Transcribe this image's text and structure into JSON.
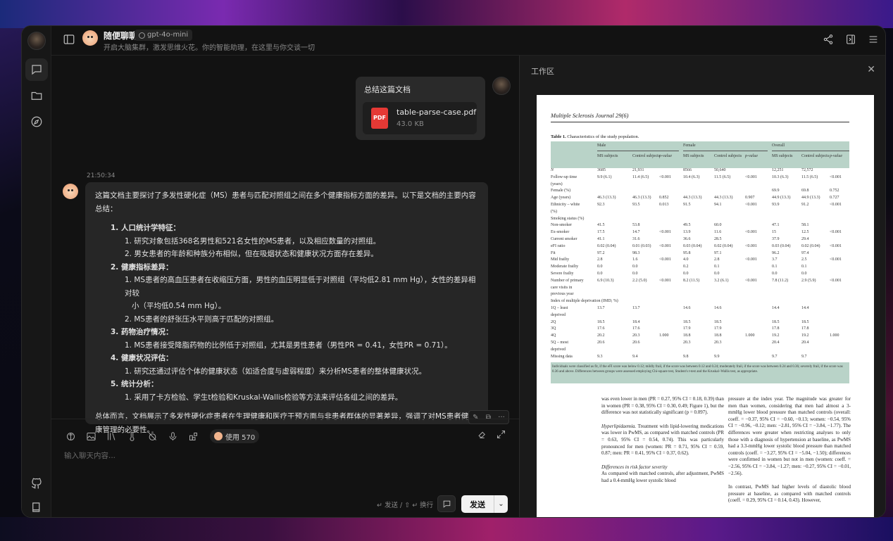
{
  "header": {
    "title": "随便聊聊",
    "model": "gpt-4o-mini",
    "subtitle": "开启大脑集群，激发思维火花。你的智能助理，在这里与你交谈一切"
  },
  "messages": {
    "user_text": "总结这篇文档",
    "file_name": "table-parse-case.pdf",
    "file_size": "43.0 KB",
    "file_type": "PDF",
    "timestamp": "21:50:34",
    "reply": {
      "intro": "这篇文档主要探讨了多发性硬化症（MS）患者与匹配对照组之间在多个健康指标方面的差异。以下是文档的主要内容总结：",
      "s1": "1. 人口统计学特征：",
      "s1_1": "1. 研究对象包括368名男性和521名女性的MS患者，以及相应数量的对照组。",
      "s1_2": "2. 男女患者的年龄和种族分布相似，但在吸烟状态和健康状况方面存在差异。",
      "s2": "2. 健康指标差异：",
      "s2_1a": "1. MS患者的高血压患者在收缩压方面，男性的血压明显低于对照组（平均低2.81 mm Hg），女性的差异相对较",
      "s2_1b": "小（平均低0.54 mm Hg）。",
      "s2_2": "2. MS患者的舒张压水平则高于匹配的对照组。",
      "s3": "3. 药物治疗情况：",
      "s3_1": "1. MS患者接受降脂药物的比例低于对照组，尤其是男性患者（男性PR = 0.41，女性PR = 0.71）。",
      "s4": "4. 健康状况评估：",
      "s4_1": "1. 研究还通过评估个体的健康状态（如适合度与虚弱程度）来分析MS患者的整体健康状况。",
      "s5": "5. 统计分析：",
      "s5_1": "1. 采用了卡方检验、学生t检验和Kruskal-Wallis检验等方法来评估各组之间的差异。",
      "outro_a": "总体而言，文档展示了多发性硬化症患者在生理健康和医疗干预方面与非患者群体的显著差异，强调了对MS患者健",
      "outro_b": "康管理的必要性。"
    },
    "actions": [
      "✎",
      "⧉",
      "···"
    ]
  },
  "composer": {
    "usage_label": "使用 570",
    "placeholder": "输入聊天内容...",
    "send_hint": "↵ 发送 / ⇧ ↵ 换行",
    "send_label": "发送",
    "send_dropdown": "⌄"
  },
  "workspace": {
    "title": "工作区",
    "close": "✕",
    "doc": {
      "journal": "Multiple Sclerosis Journal 29(6)",
      "table_caption_bold": "Table 1.",
      "table_caption": "Characteristics of the study population.",
      "group_headers": [
        "Male",
        "Female",
        "Overall"
      ],
      "sub_headers": [
        "MS subjects",
        "Control subjects",
        "p-value",
        "MS subjects",
        "Control subjects",
        "p-value",
        "MS subjects",
        "Control subjects",
        "p-value"
      ],
      "rows": [
        {
          "label": "N",
          "v": [
            "3685",
            "21,931",
            "",
            "8566",
            "50,640",
            "",
            "12,251",
            "72,572",
            ""
          ]
        },
        {
          "label": "Follow-up time",
          "v": [
            "9.9 (6.1)",
            "11.4 (6.5)",
            "<0.001",
            "10.4 (6.3)",
            "11.5 (6.5)",
            "<0.001",
            "10.3 (6.3)",
            "11.5 (6.5)",
            "<0.001"
          ]
        },
        {
          "label": "(years)",
          "v": [
            "",
            "",
            "",
            "",
            "",
            "",
            "",
            "",
            ""
          ]
        },
        {
          "label": "Female (%)",
          "v": [
            "",
            "",
            "",
            "",
            "",
            "",
            "69.9",
            "69.8",
            "0.752"
          ]
        },
        {
          "label": "Age (years)",
          "v": [
            "46.3 (13.3)",
            "46.3 (13.3)",
            "0.852",
            "44.3 (13.3)",
            "44.3 (13.3)",
            "0.907",
            "44.9 (13.3)",
            "44.9 (13.3)",
            "0.727"
          ]
        },
        {
          "label": "Ethnicity – white",
          "v": [
            "92.3",
            "93.5",
            "0.013",
            "91.5",
            "94.1",
            "<0.001",
            "93.9",
            "91.2",
            "<0.001"
          ]
        },
        {
          "label": "(%)",
          "v": [
            "",
            "",
            "",
            "",
            "",
            "",
            "",
            "",
            ""
          ]
        },
        {
          "label": "Smoking status (%)",
          "v": [
            "",
            "",
            "",
            "",
            "",
            "",
            "",
            "",
            ""
          ]
        },
        {
          "label": "   Non-smoker",
          "v": [
            "41.5",
            "53.8",
            "",
            "49.5",
            "60.0",
            "",
            "47.1",
            "58.1",
            ""
          ]
        },
        {
          "label": "   Ex-smoker",
          "v": [
            "17.5",
            "14.7",
            "<0.001",
            "13.9",
            "11.6",
            "<0.001",
            "15",
            "12.5",
            "<0.001"
          ]
        },
        {
          "label": "   Current smoker",
          "v": [
            "41.1",
            "31.6",
            "",
            "36.6",
            "28.5",
            "",
            "37.9",
            "29.4",
            ""
          ]
        },
        {
          "label": "eFI ratio",
          "v": [
            "0.02 (0.04)",
            "0.01 (0.03)",
            "<0.001",
            "0.03 (0.04)",
            "0.02 (0.04)",
            "<0.001",
            "0.03 (0.04)",
            "0.02 (0.04)",
            "<0.001"
          ]
        },
        {
          "label": "   Fit",
          "v": [
            "97.2",
            "98.3",
            "",
            "95.8",
            "97.1",
            "",
            "96.2",
            "97.4",
            ""
          ]
        },
        {
          "label": "   Mid frailty",
          "v": [
            "2.8",
            "1.6",
            "<0.001",
            "4.0",
            "2.8",
            "<0.001",
            "3.7",
            "2.5",
            "<0.001"
          ]
        },
        {
          "label": "   Moderate frailty",
          "v": [
            "0.0",
            "0.0",
            "",
            "0.2",
            "0.1",
            "",
            "0.1",
            "0.1",
            ""
          ]
        },
        {
          "label": "   Severe frailty",
          "v": [
            "0.0",
            "0.0",
            "",
            "0.0",
            "0.0",
            "",
            "0.0",
            "0.0",
            ""
          ]
        },
        {
          "label": "Number of primary",
          "v": [
            "6.9 (10.3)",
            "2.2 (5.0)",
            "<0.001",
            "8.2 (11.5)",
            "3.2 (6.1)",
            "<0.001",
            "7.8 (11.2)",
            "2.9 (5.9)",
            "<0.001"
          ]
        },
        {
          "label": "care visits in",
          "v": [
            "",
            "",
            "",
            "",
            "",
            "",
            "",
            "",
            ""
          ]
        },
        {
          "label": "previous year",
          "v": [
            "",
            "",
            "",
            "",
            "",
            "",
            "",
            "",
            ""
          ]
        },
        {
          "label": "Index of multiple deprivation (IMD; %)",
          "v": [
            "",
            "",
            "",
            "",
            "",
            "",
            "",
            "",
            ""
          ]
        },
        {
          "label": "   1Q – least",
          "v": [
            "13.7",
            "13.7",
            "",
            "14.6",
            "14.6",
            "",
            "14.4",
            "14.4",
            ""
          ]
        },
        {
          "label": "   deprived",
          "v": [
            "",
            "",
            "",
            "",
            "",
            "",
            "",
            "",
            ""
          ]
        },
        {
          "label": "   2Q",
          "v": [
            "18.5",
            "18.4",
            "",
            "18.5",
            "18.5",
            "",
            "18.5",
            "18.5",
            ""
          ]
        },
        {
          "label": "   3Q",
          "v": [
            "17.6",
            "17.6",
            "",
            "17.9",
            "17.9",
            "",
            "17.8",
            "17.8",
            ""
          ]
        },
        {
          "label": "   4Q",
          "v": [
            "20.2",
            "20.3",
            "1.000",
            "18.8",
            "18.8",
            "1.000",
            "19.2",
            "19.2",
            "1.000"
          ]
        },
        {
          "label": "   5Q – most",
          "v": [
            "20.6",
            "20.6",
            "",
            "20.3",
            "20.3",
            "",
            "20.4",
            "20.4",
            ""
          ]
        },
        {
          "label": "   deprived",
          "v": [
            "",
            "",
            "",
            "",
            "",
            "",
            "",
            "",
            ""
          ]
        },
        {
          "label": "   Missing data",
          "v": [
            "9.3",
            "9.4",
            "",
            "9.8",
            "9.9",
            "",
            "9.7",
            "9.7",
            ""
          ]
        }
      ],
      "footnote": "Individuals were classified as fit, if the eFI score was below 0.12; mildly frail, if the score was between 0.12 and 0.24; moderately frail, if the score was between 0.24 and 0.36; severely frail, if the score was 0.36 and above. Differences between groups were assessed employing Chi-square test, Student's t-test and the Kruskal–Wallis test, as appropriate.",
      "col_left_1": "was even lower in men (PR = 0.27, 95% CI = 0.18, 0.39) than in women (PR = 0.38, 95% CI = 0.30, 0.49; Figure 1), but the difference was not statistically significant (p = 0.097).",
      "col_left_2_em": "Hyperlipidaemia.",
      "col_left_2": " Treatment with lipid-lowering medications was lower in PwMS, as compared with matched controls (PR = 0.63, 95% CI = 0.54, 0.74). This was particularly pronounced for men (women: PR = 0.71, 95% CI = 0.59, 0.87; men: PR = 0.41, 95% CI = 0.37, 0.62).",
      "col_left_3_em": "Differences in risk factor severity",
      "col_left_4": "As compared with matched controls, after adjustment, PwMS had a 0.4-mmHg lower systolic blood",
      "col_right_1": "pressure at the index year. The magnitude was greater for men than women, considering that men had almost a 3-mmHg lower blood pressure than matched controls (overall: coeff. = −0.37, 95% CI = −0.60, −0.13; women: −0.54, 95% CI = −0.96, −0.12; men: −2.81, 95% CI = −3.84, −1.77). The differences were greater when restricting analyses to only those with a diagnosis of hypertension at baseline, as PwMS had a 3.3-mmHg lower systolic blood pressure than matched controls (coeff. = −3.27, 95% CI = −5.04, −1.50); differences were confirmed in women but not in men (women: coeff. = −2.56, 95% CI = −3.84, −1.27; men: −0.27, 95% CI = −0.01, −2.56).",
      "col_right_2": "In contrast, PwMS had higher levels of diastolic blood pressure at baseline, as compared with matched controls (coeff. = 0.29, 95% CI = 0.14, 0.43). However,"
    }
  }
}
